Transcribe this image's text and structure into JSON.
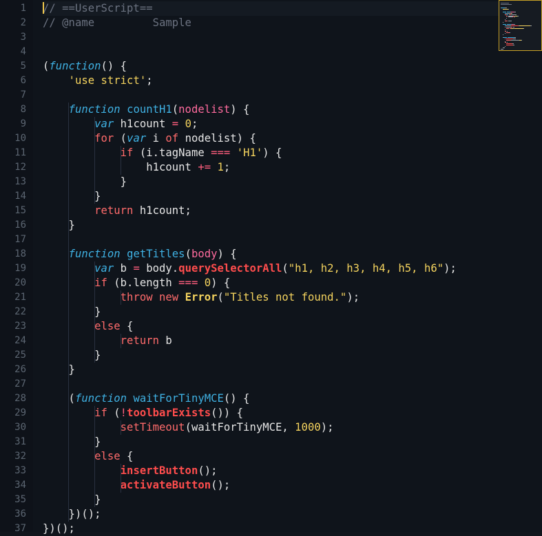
{
  "lines": [
    {
      "n": "1",
      "tokens": [
        {
          "t": "// ==UserScript==",
          "c": "c-com"
        }
      ]
    },
    {
      "n": "2",
      "tokens": [
        {
          "t": "// @name         Sample",
          "c": "c-com"
        }
      ]
    },
    {
      "n": "3",
      "tokens": []
    },
    {
      "n": "4",
      "tokens": []
    },
    {
      "n": "5",
      "tokens": [
        {
          "t": "(",
          "c": "c-plain"
        },
        {
          "t": "function",
          "c": "c-fn-kw"
        },
        {
          "t": "() {",
          "c": "c-plain"
        }
      ]
    },
    {
      "n": "6",
      "tokens": [
        {
          "t": "    ",
          "c": "c-plain"
        },
        {
          "t": "'use strict'",
          "c": "c-str"
        },
        {
          "t": ";",
          "c": "c-plain"
        }
      ]
    },
    {
      "n": "7",
      "tokens": []
    },
    {
      "n": "8",
      "tokens": [
        {
          "t": "    ",
          "c": "c-plain"
        },
        {
          "t": "function",
          "c": "c-fn-kw"
        },
        {
          "t": " ",
          "c": "c-plain"
        },
        {
          "t": "countH1",
          "c": "c-fn"
        },
        {
          "t": "(",
          "c": "c-plain"
        },
        {
          "t": "nodelist",
          "c": "c-param"
        },
        {
          "t": ") {",
          "c": "c-plain"
        }
      ]
    },
    {
      "n": "9",
      "tokens": [
        {
          "t": "        ",
          "c": "c-plain"
        },
        {
          "t": "var",
          "c": "c-fn-kw"
        },
        {
          "t": " h1count ",
          "c": "c-plain"
        },
        {
          "t": "=",
          "c": "c-op"
        },
        {
          "t": " ",
          "c": "c-plain"
        },
        {
          "t": "0",
          "c": "c-num"
        },
        {
          "t": ";",
          "c": "c-plain"
        }
      ]
    },
    {
      "n": "10",
      "tokens": [
        {
          "t": "        ",
          "c": "c-plain"
        },
        {
          "t": "for",
          "c": "c-kw"
        },
        {
          "t": " (",
          "c": "c-plain"
        },
        {
          "t": "var",
          "c": "c-fn-kw"
        },
        {
          "t": " i ",
          "c": "c-plain"
        },
        {
          "t": "of",
          "c": "c-kw"
        },
        {
          "t": " nodelist) {",
          "c": "c-plain"
        }
      ]
    },
    {
      "n": "11",
      "tokens": [
        {
          "t": "            ",
          "c": "c-plain"
        },
        {
          "t": "if",
          "c": "c-kw"
        },
        {
          "t": " (i.tagName ",
          "c": "c-plain"
        },
        {
          "t": "===",
          "c": "c-op"
        },
        {
          "t": " ",
          "c": "c-plain"
        },
        {
          "t": "'H1'",
          "c": "c-str"
        },
        {
          "t": ") {",
          "c": "c-plain"
        }
      ]
    },
    {
      "n": "12",
      "tokens": [
        {
          "t": "                h1count ",
          "c": "c-plain"
        },
        {
          "t": "+=",
          "c": "c-op"
        },
        {
          "t": " ",
          "c": "c-plain"
        },
        {
          "t": "1",
          "c": "c-num"
        },
        {
          "t": ";",
          "c": "c-plain"
        }
      ]
    },
    {
      "n": "13",
      "tokens": [
        {
          "t": "            }",
          "c": "c-plain"
        }
      ]
    },
    {
      "n": "14",
      "tokens": [
        {
          "t": "        }",
          "c": "c-plain"
        }
      ]
    },
    {
      "n": "15",
      "tokens": [
        {
          "t": "        ",
          "c": "c-plain"
        },
        {
          "t": "return",
          "c": "c-kw"
        },
        {
          "t": " h1count;",
          "c": "c-plain"
        }
      ]
    },
    {
      "n": "16",
      "tokens": [
        {
          "t": "    }",
          "c": "c-plain"
        }
      ]
    },
    {
      "n": "17",
      "tokens": []
    },
    {
      "n": "18",
      "tokens": [
        {
          "t": "    ",
          "c": "c-plain"
        },
        {
          "t": "function",
          "c": "c-fn-kw"
        },
        {
          "t": " ",
          "c": "c-plain"
        },
        {
          "t": "getTitles",
          "c": "c-fn"
        },
        {
          "t": "(",
          "c": "c-plain"
        },
        {
          "t": "body",
          "c": "c-param"
        },
        {
          "t": ") {",
          "c": "c-plain"
        }
      ]
    },
    {
      "n": "19",
      "tokens": [
        {
          "t": "        ",
          "c": "c-plain"
        },
        {
          "t": "var",
          "c": "c-fn-kw"
        },
        {
          "t": " b ",
          "c": "c-plain"
        },
        {
          "t": "=",
          "c": "c-op"
        },
        {
          "t": " body.",
          "c": "c-plain"
        },
        {
          "t": "querySelectorAll",
          "c": "c-meth"
        },
        {
          "t": "(",
          "c": "c-plain"
        },
        {
          "t": "\"h1, h2, h3, h4, h5, h6\"",
          "c": "c-str"
        },
        {
          "t": ");",
          "c": "c-plain"
        }
      ]
    },
    {
      "n": "20",
      "tokens": [
        {
          "t": "        ",
          "c": "c-plain"
        },
        {
          "t": "if",
          "c": "c-kw"
        },
        {
          "t": " (b.length ",
          "c": "c-plain"
        },
        {
          "t": "===",
          "c": "c-op"
        },
        {
          "t": " ",
          "c": "c-plain"
        },
        {
          "t": "0",
          "c": "c-num"
        },
        {
          "t": ") {",
          "c": "c-plain"
        }
      ]
    },
    {
      "n": "21",
      "tokens": [
        {
          "t": "            ",
          "c": "c-plain"
        },
        {
          "t": "throw",
          "c": "c-kw"
        },
        {
          "t": " ",
          "c": "c-plain"
        },
        {
          "t": "new",
          "c": "c-kw"
        },
        {
          "t": " ",
          "c": "c-plain"
        },
        {
          "t": "Error",
          "c": "c-cls"
        },
        {
          "t": "(",
          "c": "c-plain"
        },
        {
          "t": "\"Titles not found.\"",
          "c": "c-str"
        },
        {
          "t": ");",
          "c": "c-plain"
        }
      ]
    },
    {
      "n": "22",
      "tokens": [
        {
          "t": "        }",
          "c": "c-plain"
        }
      ]
    },
    {
      "n": "23",
      "tokens": [
        {
          "t": "        ",
          "c": "c-plain"
        },
        {
          "t": "else",
          "c": "c-kw"
        },
        {
          "t": " {",
          "c": "c-plain"
        }
      ]
    },
    {
      "n": "24",
      "tokens": [
        {
          "t": "            ",
          "c": "c-plain"
        },
        {
          "t": "return",
          "c": "c-kw"
        },
        {
          "t": " b",
          "c": "c-plain"
        }
      ]
    },
    {
      "n": "25",
      "tokens": [
        {
          "t": "        }",
          "c": "c-plain"
        }
      ]
    },
    {
      "n": "26",
      "tokens": [
        {
          "t": "    }",
          "c": "c-plain"
        }
      ]
    },
    {
      "n": "27",
      "tokens": []
    },
    {
      "n": "28",
      "tokens": [
        {
          "t": "    (",
          "c": "c-plain"
        },
        {
          "t": "function",
          "c": "c-fn-kw"
        },
        {
          "t": " ",
          "c": "c-plain"
        },
        {
          "t": "waitForTinyMCE",
          "c": "c-fn"
        },
        {
          "t": "() {",
          "c": "c-plain"
        }
      ]
    },
    {
      "n": "29",
      "tokens": [
        {
          "t": "        ",
          "c": "c-plain"
        },
        {
          "t": "if",
          "c": "c-kw"
        },
        {
          "t": " (",
          "c": "c-plain"
        },
        {
          "t": "!",
          "c": "c-op"
        },
        {
          "t": "toolbarExists",
          "c": "c-meth"
        },
        {
          "t": "()) {",
          "c": "c-plain"
        }
      ]
    },
    {
      "n": "30",
      "tokens": [
        {
          "t": "            ",
          "c": "c-plain"
        },
        {
          "t": "setTimeout",
          "c": "c-kw"
        },
        {
          "t": "(waitForTinyMCE, ",
          "c": "c-plain"
        },
        {
          "t": "1000",
          "c": "c-num"
        },
        {
          "t": ");",
          "c": "c-plain"
        }
      ]
    },
    {
      "n": "31",
      "tokens": [
        {
          "t": "        }",
          "c": "c-plain"
        }
      ]
    },
    {
      "n": "32",
      "tokens": [
        {
          "t": "        ",
          "c": "c-plain"
        },
        {
          "t": "else",
          "c": "c-kw"
        },
        {
          "t": " {",
          "c": "c-plain"
        }
      ]
    },
    {
      "n": "33",
      "tokens": [
        {
          "t": "            ",
          "c": "c-plain"
        },
        {
          "t": "insertButton",
          "c": "c-meth"
        },
        {
          "t": "();",
          "c": "c-plain"
        }
      ]
    },
    {
      "n": "34",
      "tokens": [
        {
          "t": "            ",
          "c": "c-plain"
        },
        {
          "t": "activateButton",
          "c": "c-meth"
        },
        {
          "t": "();",
          "c": "c-plain"
        }
      ]
    },
    {
      "n": "35",
      "tokens": [
        {
          "t": "        }",
          "c": "c-plain"
        }
      ]
    },
    {
      "n": "36",
      "tokens": [
        {
          "t": "    })();",
          "c": "c-plain"
        }
      ]
    },
    {
      "n": "37",
      "tokens": [
        {
          "t": "})();",
          "c": "c-plain"
        }
      ]
    }
  ],
  "colors": {
    "background": "#0f141b",
    "comment": "#6b7280",
    "keyword": "#ff6b6b",
    "function_keyword": "#3fb1e3",
    "string": "#f4d35e",
    "method": "#ff4d4d",
    "minimap_border": "#c9a227"
  }
}
